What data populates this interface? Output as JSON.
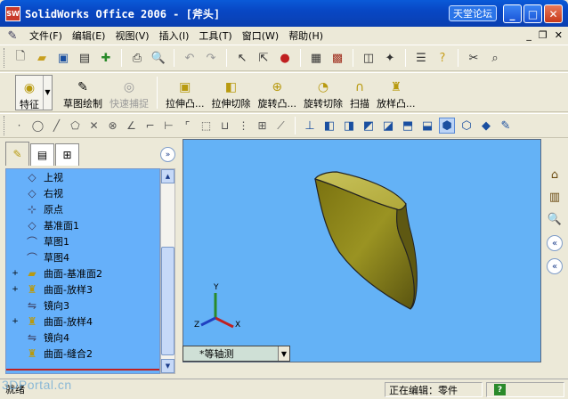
{
  "window": {
    "title": "SolidWorks Office 2006 - [斧头]",
    "app_icon_label": "SW",
    "brand": "天堂论坛",
    "minimize": "_",
    "maximize": "□",
    "close": "✕"
  },
  "menubar": {
    "items": [
      {
        "label": "文件(F)"
      },
      {
        "label": "编辑(E)"
      },
      {
        "label": "视图(V)"
      },
      {
        "label": "插入(I)"
      },
      {
        "label": "工具(T)"
      },
      {
        "label": "窗口(W)"
      },
      {
        "label": "帮助(H)"
      }
    ],
    "mdi": {
      "minimize": "_",
      "restore": "❐",
      "close": "✕"
    }
  },
  "feature_toolbar": {
    "feature": "特征",
    "sketch": "草图绘制",
    "quick_snap": "快速捕捉",
    "extrude_boss": "拉伸凸...",
    "extrude_cut": "拉伸切除",
    "revolve_boss": "旋转凸...",
    "revolve_cut": "旋转切除",
    "sweep": "扫描",
    "loft_boss": "放样凸..."
  },
  "tree": {
    "items": [
      {
        "label": "上视",
        "icon": "plane-icon",
        "expander": ""
      },
      {
        "label": "右视",
        "icon": "plane-icon",
        "expander": ""
      },
      {
        "label": "原点",
        "icon": "origin-icon",
        "expander": ""
      },
      {
        "label": "基准面1",
        "icon": "plane-icon",
        "expander": ""
      },
      {
        "label": "草图1",
        "icon": "sketch-icon",
        "expander": ""
      },
      {
        "label": "草图4",
        "icon": "sketch-icon",
        "expander": ""
      },
      {
        "label": "曲面-基准面2",
        "icon": "surface-icon",
        "expander": "+"
      },
      {
        "label": "曲面-放样3",
        "icon": "loft-icon",
        "expander": "+"
      },
      {
        "label": "镜向3",
        "icon": "mirror-icon",
        "expander": ""
      },
      {
        "label": "曲面-放样4",
        "icon": "loft-icon",
        "expander": "+"
      },
      {
        "label": "镜向4",
        "icon": "mirror-icon",
        "expander": ""
      },
      {
        "label": "曲面-缝合2",
        "icon": "knit-icon",
        "expander": ""
      }
    ]
  },
  "viewport": {
    "view_orientation": "*等轴测",
    "axis_x": "X",
    "axis_y": "Y",
    "axis_z": "Z"
  },
  "status": {
    "left": "就绪",
    "editing": "正在编辑：零件",
    "help": "?"
  },
  "watermark": "3DPortal.cn"
}
